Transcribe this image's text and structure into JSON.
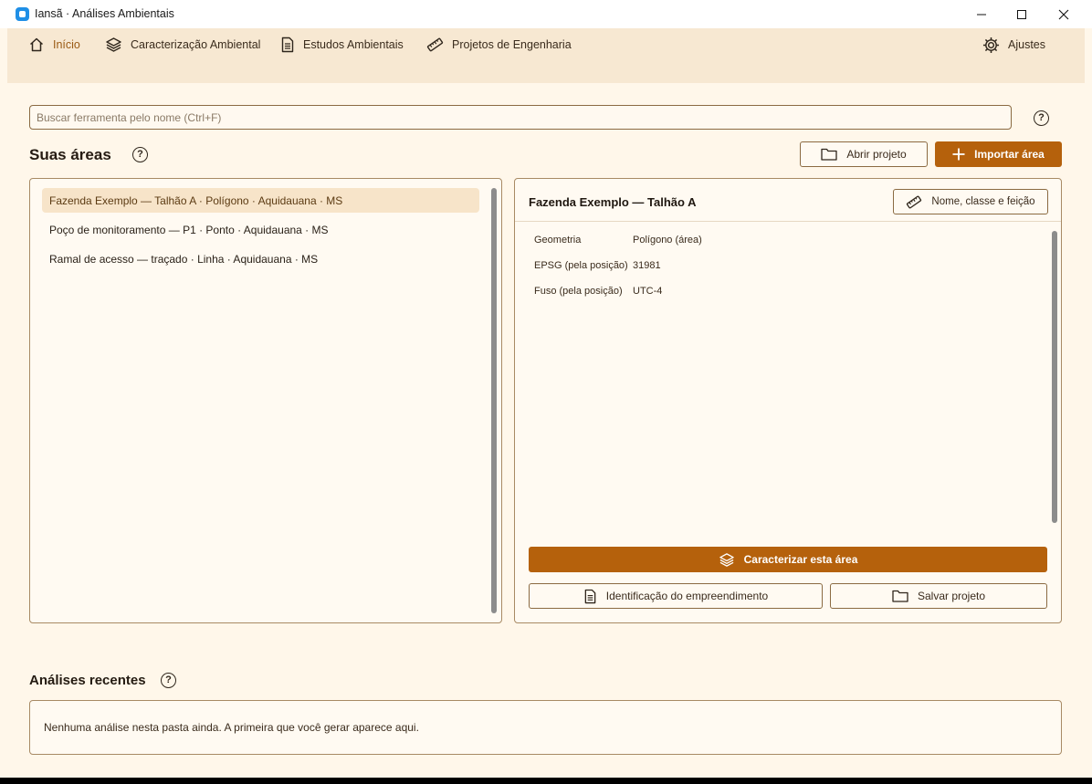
{
  "window": {
    "title": "Iansã · Análises Ambientais"
  },
  "nav": {
    "items": [
      {
        "label": "Início"
      },
      {
        "label": "Caracterização Ambiental"
      },
      {
        "label": "Estudos Ambientais"
      },
      {
        "label": "Projetos de Engenharia"
      }
    ],
    "settings_label": "Ajustes"
  },
  "search": {
    "placeholder": "Buscar ferramenta pelo nome (Ctrl+F)",
    "value": ""
  },
  "areas": {
    "title": "Suas áreas",
    "open_project_label": "Abrir projeto",
    "import_label": "Importar área",
    "items": [
      {
        "label": "Fazenda Exemplo — Talhão A · Polígono · Aquidauana · MS",
        "selected": true
      },
      {
        "label": "Poço de monitoramento — P1 · Ponto · Aquidauana · MS",
        "selected": false
      },
      {
        "label": "Ramal de acesso — traçado · Linha · Aquidauana · MS",
        "selected": false
      }
    ]
  },
  "detail": {
    "title": "Fazenda Exemplo — Talhão A",
    "edit_label": "Nome, classe e feição",
    "props": [
      {
        "label": "Geometria",
        "value": "Polígono (área)"
      },
      {
        "label": "EPSG (pela posição)",
        "value": "31981"
      },
      {
        "label": "Fuso (pela posição)",
        "value": "UTC-4"
      }
    ],
    "characterize_label": "Caracterizar esta área",
    "identify_label": "Identificação do empreendimento",
    "save_label": "Salvar projeto"
  },
  "recent": {
    "title": "Análises recentes",
    "empty_text": "Nenhuma análise nesta pasta ainda. A primeira que você gerar aparece aqui."
  },
  "colors": {
    "accent": "#b5610c",
    "nav_bg": "#f7e8d2",
    "page_bg": "#fff7ea",
    "border": "#a88a64"
  },
  "help_glyph": "?"
}
